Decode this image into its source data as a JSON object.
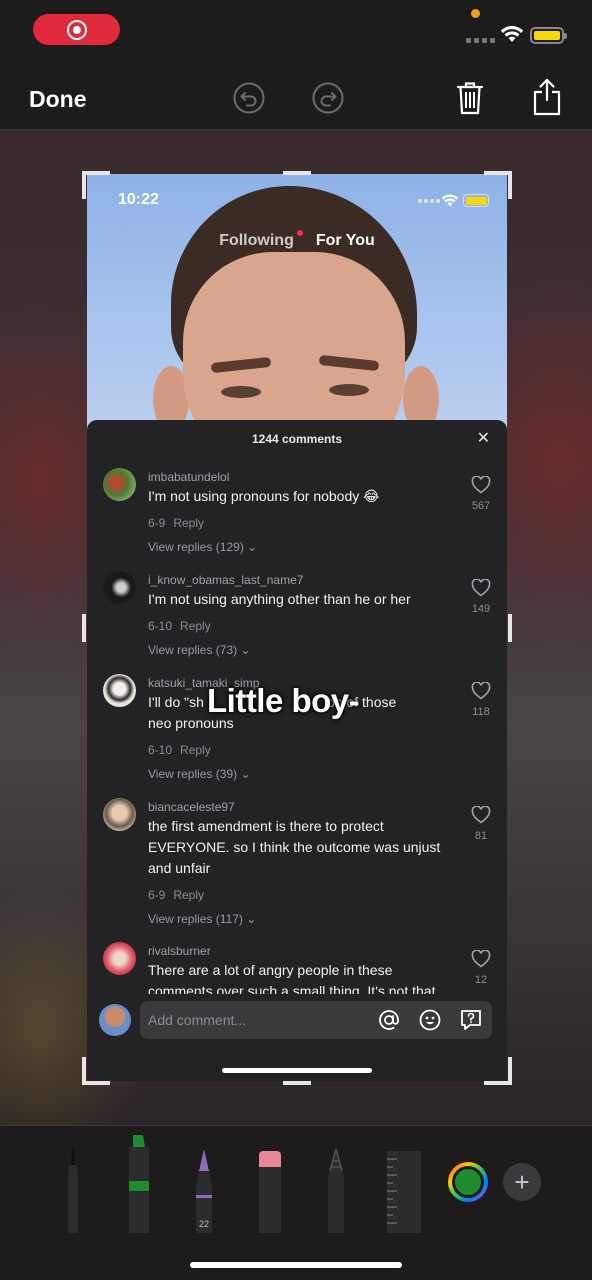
{
  "status_bar": {
    "recording": true
  },
  "toolbar": {
    "done_label": "Done",
    "icons": [
      "undo-icon",
      "redo-icon",
      "trash-icon",
      "share-icon"
    ]
  },
  "screenshot": {
    "time": "10:22",
    "tabs": {
      "following": "Following",
      "for_you": "For You"
    },
    "caption": "Little boy-",
    "comments_header": "1244 comments",
    "comments": [
      {
        "user": "imbabatundelol",
        "text": "I'm not using pronouns for nobody 😂",
        "date": "6-9",
        "reply": "Reply",
        "view_replies": "View replies (129)",
        "likes": "567"
      },
      {
        "user": "i_know_obamas_last_name7",
        "text": "I'm not using anything other than he or her",
        "date": "6-10",
        "reply": "Reply",
        "view_replies": "View replies (73)",
        "likes": "149"
      },
      {
        "user": "katsuki_tamaki_simp",
        "text": "I'll do \"sh",
        "text_tail": "ion of those",
        "text_line2": "neo pronouns",
        "date": "6-10",
        "reply": "Reply",
        "view_replies": "View replies (39)",
        "likes": "118"
      },
      {
        "user": "biancaceleste97",
        "text": "the first amendment is there to protect EVERYONE. so I think the outcome was unjust and unfair",
        "date": "6-9",
        "reply": "Reply",
        "view_replies": "View replies (117)",
        "likes": "81"
      },
      {
        "user": "rivalsburner",
        "text": "There are a lot of angry people in these comments over such a small thing. It's not that",
        "likes": "12"
      }
    ],
    "input_placeholder": "Add comment..."
  },
  "tools": {
    "marker_size": "22",
    "accent_green": "#1e8c2e",
    "accent_purple": "#8e6bbf",
    "accent_pink": "#e6889a",
    "color_swatch": "#1e8c2e"
  }
}
